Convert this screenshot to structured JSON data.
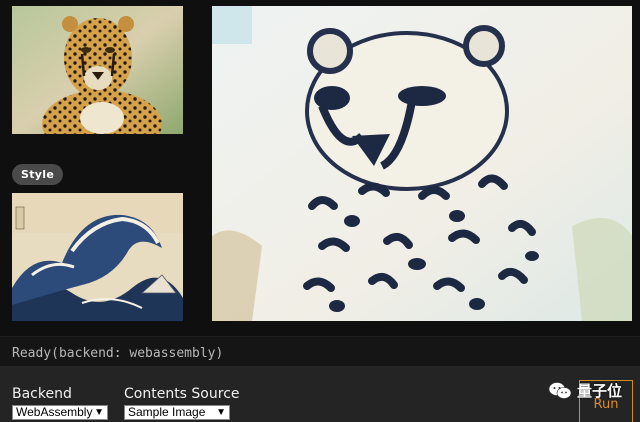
{
  "images": {
    "content_thumb_icon": "cheetah-photo",
    "style_thumb_icon": "great-wave-painting",
    "result_icon": "stylized-cheetah"
  },
  "style_label": "Style",
  "status": "Ready(backend: webassembly)",
  "controls": {
    "backend_label": "Backend",
    "backend_value": "WebAssembly",
    "source_label": "Contents Source",
    "source_value": "Sample Image",
    "run_label": "Run"
  },
  "watermark": {
    "text": "量子位",
    "icon": "wechat-icon"
  },
  "colors": {
    "accent": "#d98a2a",
    "panel": "#242424",
    "background": "#0f0f0f"
  }
}
